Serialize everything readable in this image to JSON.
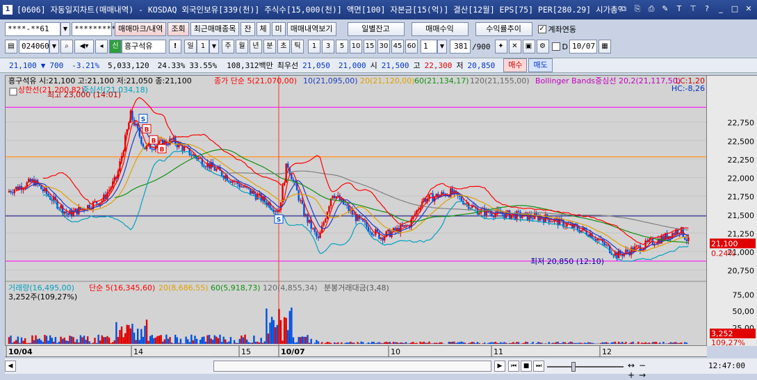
{
  "title": {
    "num": "1",
    "text": "[0606] 자동일지차트(매매내역) - KOSDAQ 외국인보유[339(천)] 주식수[15,000(천)] 액면[100] 자본금[15(억)] 결산[12월] EPS[75] PER[280.29] 시가총액[3,165"
  },
  "toolbar1": {
    "account": "****-**61",
    "password": "*********",
    "btn_markers": "매매마크/내역",
    "btn_query": "조회",
    "btn_recent": "최근매매종목",
    "btn_jan": "잔",
    "btn_che": "체",
    "btn_mi": "미",
    "btn_view": "매매내역보기",
    "btn_daily": "일별잔고",
    "btn_profit": "매매수익",
    "btn_trend": "수익률추이",
    "link_label": "계좌연동"
  },
  "toolbar2": {
    "code": "024060",
    "badge": "신",
    "name": "흥구석유",
    "excl": "!",
    "period_day": "일",
    "period_num": "1",
    "p_week": "주",
    "p_month": "월",
    "p_year": "년",
    "p_min": "분",
    "p_sec": "초",
    "p_tick": "틱",
    "intervals": [
      "1",
      "3",
      "5",
      "10",
      "15",
      "30",
      "45",
      "60"
    ],
    "mult": "1",
    "count": "381",
    "count_total": "/900",
    "d_label": "D",
    "date": "10/07"
  },
  "quote": {
    "price": "21,100",
    "change": "700",
    "pct": "-3.21%",
    "volume": "5,033,120",
    "rate1": "24.33%",
    "rate2": "33.55%",
    "amount": "108,312백만",
    "best_label": "최우선",
    "best_ask": "21,050",
    "best_bid": "21,000",
    "open_label": "시",
    "open": "21,500",
    "high_label": "고",
    "high": "22,300",
    "low_label": "저",
    "low": "20,850",
    "buy": "매수",
    "sell": "매도"
  },
  "legend_price": {
    "stock": "흥구석유 시:21,100 고:21,100 저:21,050 종:21,100",
    "ma_label": "종가 단순",
    "ma5": "5(21,070,00)",
    "ma10": "10(21,095,00)",
    "ma20": "20(21,120,00)",
    "ma60": "60(21,134,17)",
    "ma120": "120(21,155,00)",
    "bb": "Bollinger Bands중심선 20,2(21,117,50)",
    "upper": "상한선(21,200,82)",
    "center": "중심선(21,034,18)",
    "max_note": "최고 23,000 (14:01)",
    "min_note": "최저 20,850 (12:10)",
    "lc": "LC:1,20",
    "hc": "HC:-8,26"
  },
  "legend_vol": {
    "vol": "거래량(16,495,00)",
    "ma_label": "단순",
    "ma5": "5(16,345,60)",
    "ma20": "20(8,686,55)",
    "ma60": "60(5,918,73)",
    "ma120": "120(4,855,34)",
    "amount": "분봉거래대금(3,48)",
    "current": "3,252주(109,27%)"
  },
  "y_price_ticks": [
    "22,750",
    "22,500",
    "22,250",
    "22,000",
    "21,750",
    "21,500",
    "21,250",
    "21,000",
    "20,750"
  ],
  "y_vol_ticks": [
    "75,00",
    "50,00",
    "25,00"
  ],
  "price_tag": "21,100",
  "price_tag_pct": "0.24%",
  "vol_tag": "3,252",
  "vol_tag_pct": "109,27%",
  "x_labels": [
    {
      "t": "10/04",
      "bold": true
    },
    {
      "t": "14",
      "bold": false
    },
    {
      "t": "15",
      "bold": false
    },
    {
      "t": "10/07",
      "bold": true
    },
    {
      "t": "10",
      "bold": false
    },
    {
      "t": "11",
      "bold": false
    },
    {
      "t": "12",
      "bold": false
    }
  ],
  "time": "12:47:00",
  "colors": {
    "up": "#e00000",
    "down": "#0050e0",
    "ma5": "#ff0000",
    "ma10": "#1a3cc8",
    "ma20": "#e0a000",
    "ma60": "#109010",
    "ma120": "#808080",
    "bb": "#00a0c0",
    "hline": "#ff00ff",
    "hline_navy": "#000080",
    "hline_orange": "#ff9933"
  }
}
